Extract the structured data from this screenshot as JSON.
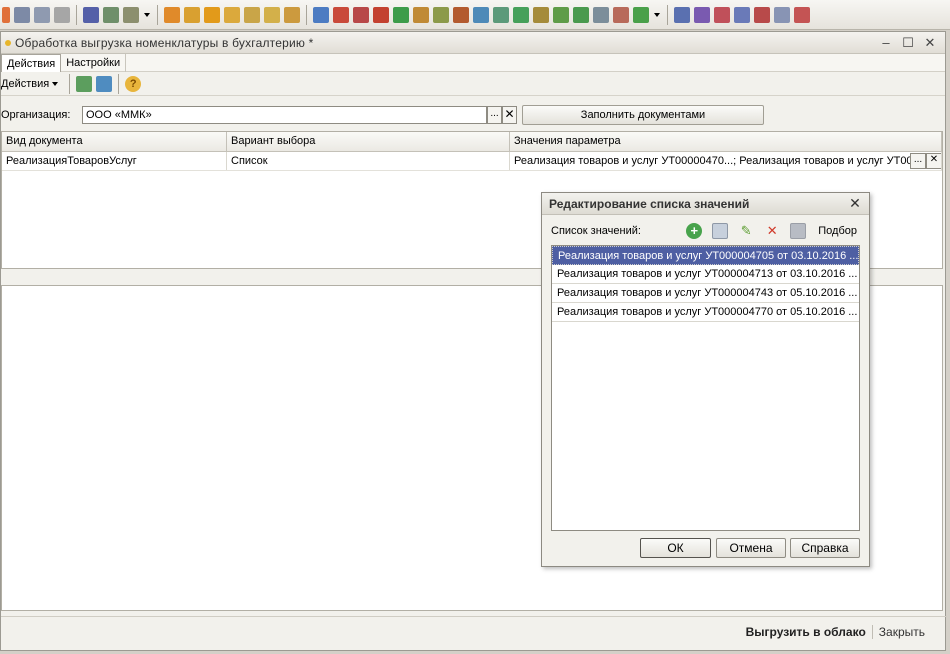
{
  "window": {
    "title": "Обработка  выгрузка номенклатуры в бухгалтерию *"
  },
  "menu": {
    "items": [
      "Действия",
      "Настройки"
    ]
  },
  "actions": {
    "label": "Действия",
    "help_glyph": "?"
  },
  "organization": {
    "label": "Организация:",
    "value": "ООО «ММК»",
    "select_glyph": "...",
    "clear_glyph": "✕",
    "fill_button": "Заполнить документами"
  },
  "grid": {
    "columns": [
      "Вид документа",
      "Вариант выбора",
      "Значения параметра"
    ],
    "rows": [
      {
        "doc_type": "РеализацияТоваровУслуг",
        "variant": "Список",
        "values": "Реализация товаров и услуг УТ00000470...; Реализация товаров и услуг УТ00..."
      }
    ],
    "cell_select_glyph": "...",
    "cell_clear_glyph": "✕"
  },
  "bottom": {
    "upload_label": "Выгрузить в облако",
    "close_label": "Закрыть"
  },
  "dialog": {
    "title": "Редактирование списка значений",
    "list_label": "Список значений:",
    "podbor_label": "Подбор",
    "items": [
      "Реализация товаров и услуг УТ000004705 от 03.10.2016 ...",
      "Реализация товаров и услуг УТ000004713 от 03.10.2016 ...",
      "Реализация товаров и услуг УТ000004743 от 05.10.2016 ...",
      "Реализация товаров и услуг УТ000004770 от 05.10.2016 ..."
    ],
    "ok_label": "ОК",
    "cancel_label": "Отмена",
    "help_label": "Справка"
  },
  "colors": {
    "selection": "#4e5fa3",
    "window_bg": "#f2f1ec",
    "desktop_bg": "#d4d0c8"
  }
}
